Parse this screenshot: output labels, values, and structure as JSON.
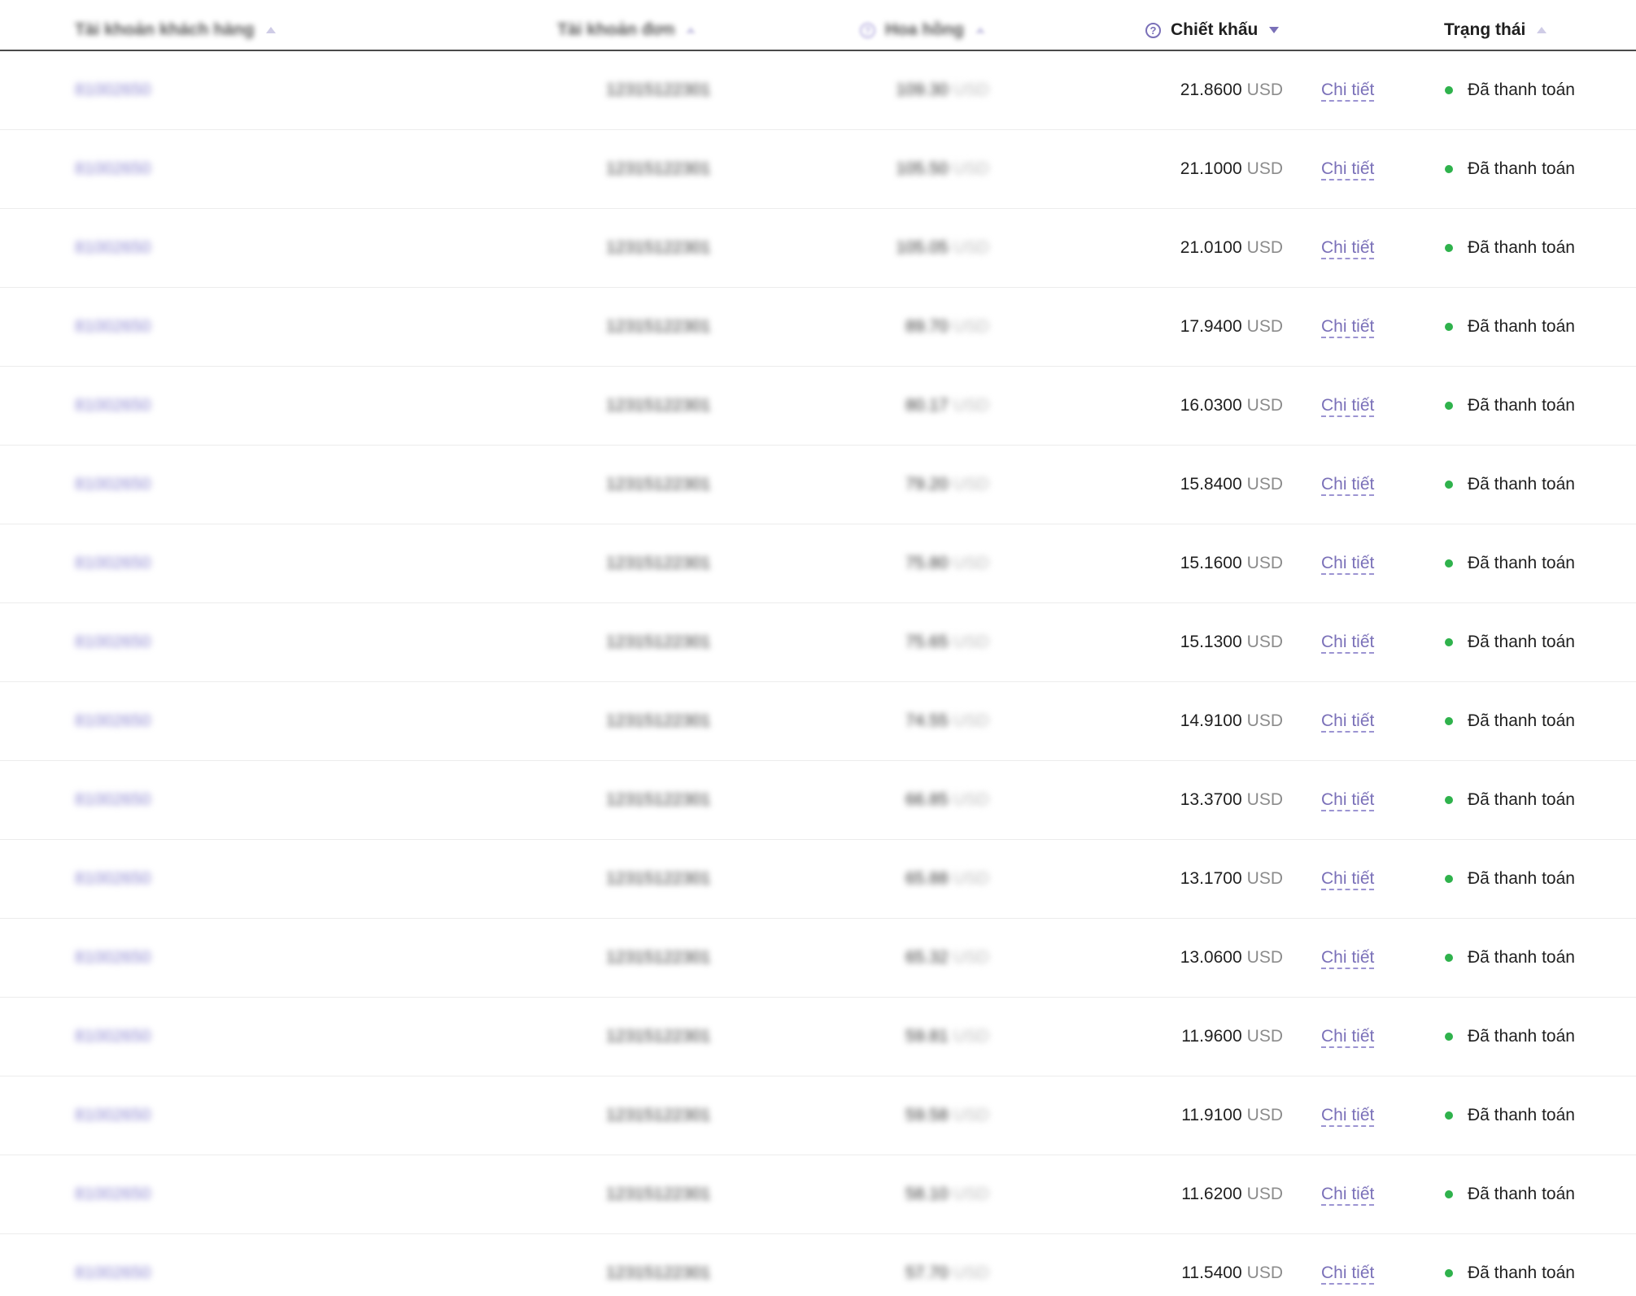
{
  "header": {
    "col_account": {
      "label": "Tài khoản khách hàng"
    },
    "col_order": {
      "label": "Tài khoản đơn"
    },
    "col_total": {
      "label": "Hoa hồng"
    },
    "col_discount": {
      "label": "Chiết khấu"
    },
    "col_status": {
      "label": "Trạng thái"
    }
  },
  "rows": [
    {
      "account": "81002650",
      "order": "12315122301",
      "total": "109.30",
      "total_unit": "USD",
      "discount": "21.8600",
      "unit": "USD",
      "detail": "Chi tiết",
      "status": "Đã thanh toán"
    },
    {
      "account": "81002650",
      "order": "12315122301",
      "total": "105.50",
      "total_unit": "USD",
      "discount": "21.1000",
      "unit": "USD",
      "detail": "Chi tiết",
      "status": "Đã thanh toán"
    },
    {
      "account": "81002650",
      "order": "12315122301",
      "total": "105.05",
      "total_unit": "USD",
      "discount": "21.0100",
      "unit": "USD",
      "detail": "Chi tiết",
      "status": "Đã thanh toán"
    },
    {
      "account": "81002650",
      "order": "12315122301",
      "total": "89.70",
      "total_unit": "USD",
      "discount": "17.9400",
      "unit": "USD",
      "detail": "Chi tiết",
      "status": "Đã thanh toán"
    },
    {
      "account": "81002650",
      "order": "12315122301",
      "total": "80.17",
      "total_unit": "USD",
      "discount": "16.0300",
      "unit": "USD",
      "detail": "Chi tiết",
      "status": "Đã thanh toán"
    },
    {
      "account": "81002650",
      "order": "12315122301",
      "total": "79.20",
      "total_unit": "USD",
      "discount": "15.8400",
      "unit": "USD",
      "detail": "Chi tiết",
      "status": "Đã thanh toán"
    },
    {
      "account": "81002650",
      "order": "12315122301",
      "total": "75.80",
      "total_unit": "USD",
      "discount": "15.1600",
      "unit": "USD",
      "detail": "Chi tiết",
      "status": "Đã thanh toán"
    },
    {
      "account": "81002650",
      "order": "12315122301",
      "total": "75.65",
      "total_unit": "USD",
      "discount": "15.1300",
      "unit": "USD",
      "detail": "Chi tiết",
      "status": "Đã thanh toán"
    },
    {
      "account": "81002650",
      "order": "12315122301",
      "total": "74.55",
      "total_unit": "USD",
      "discount": "14.9100",
      "unit": "USD",
      "detail": "Chi tiết",
      "status": "Đã thanh toán"
    },
    {
      "account": "81002650",
      "order": "12315122301",
      "total": "66.85",
      "total_unit": "USD",
      "discount": "13.3700",
      "unit": "USD",
      "detail": "Chi tiết",
      "status": "Đã thanh toán"
    },
    {
      "account": "81002650",
      "order": "12315122301",
      "total": "65.88",
      "total_unit": "USD",
      "discount": "13.1700",
      "unit": "USD",
      "detail": "Chi tiết",
      "status": "Đã thanh toán"
    },
    {
      "account": "81002650",
      "order": "12315122301",
      "total": "65.32",
      "total_unit": "USD",
      "discount": "13.0600",
      "unit": "USD",
      "detail": "Chi tiết",
      "status": "Đã thanh toán"
    },
    {
      "account": "81002650",
      "order": "12315122301",
      "total": "59.81",
      "total_unit": "USD",
      "discount": "11.9600",
      "unit": "USD",
      "detail": "Chi tiết",
      "status": "Đã thanh toán"
    },
    {
      "account": "81002650",
      "order": "12315122301",
      "total": "59.58",
      "total_unit": "USD",
      "discount": "11.9100",
      "unit": "USD",
      "detail": "Chi tiết",
      "status": "Đã thanh toán"
    },
    {
      "account": "81002650",
      "order": "12315122301",
      "total": "58.10",
      "total_unit": "USD",
      "discount": "11.6200",
      "unit": "USD",
      "detail": "Chi tiết",
      "status": "Đã thanh toán"
    },
    {
      "account": "81002650",
      "order": "12315122301",
      "total": "57.70",
      "total_unit": "USD",
      "discount": "11.5400",
      "unit": "USD",
      "detail": "Chi tiết",
      "status": "Đã thanh toán"
    }
  ],
  "colors": {
    "accent": "#7a70b8",
    "status_paid": "#2fb24c",
    "header_border": "#4a4a4a"
  }
}
